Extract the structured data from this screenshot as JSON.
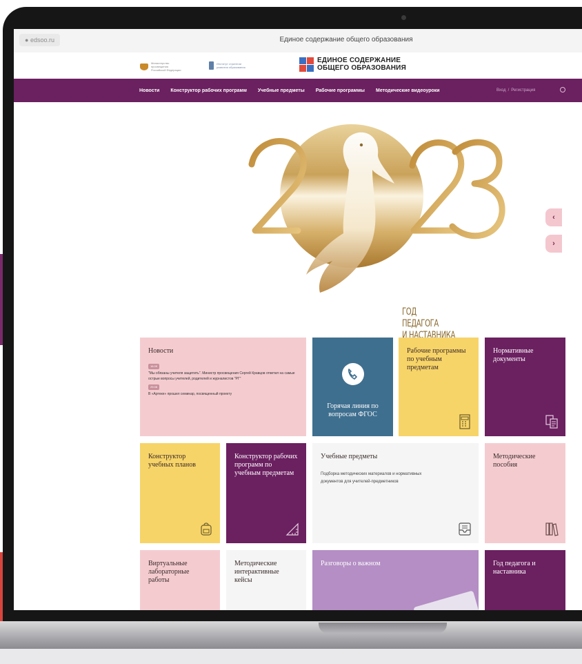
{
  "browser": {
    "url": "edsoo.ru",
    "tab_title": "Единое содержание общего образования"
  },
  "header": {
    "logo_ministry": "Министерство просвещения Российской Федерации",
    "logo_institute": "Институт стратегии развития образования",
    "logo_main_line1": "ЕДИНОЕ СОДЕРЖАНИЕ",
    "logo_main_line2": "ОБЩЕГО ОБРАЗОВАНИЯ"
  },
  "nav": {
    "items": [
      "Новости",
      "Конструктор рабочих программ",
      "Учебные предметы",
      "Рабочие программы",
      "Методические видеоуроки"
    ],
    "login": "Вход",
    "separator": "/",
    "register": "Регистрация"
  },
  "hero": {
    "year_left": "2",
    "year_right": "23",
    "caption": [
      "ГОД",
      "ПЕДАГОГА",
      "И НАСТАВНИКА"
    ],
    "arrow_prev": "‹",
    "arrow_next": "›",
    "slide_count": 4,
    "active_slide": 0
  },
  "colors": {
    "purple": "#6b2060",
    "pink": "#f4ccd0",
    "yellow": "#f7d468",
    "blue": "#3f6f8f",
    "lavender": "#b48ec4",
    "light": "#f5f5f5",
    "gold": "#c59a4a"
  },
  "tiles": {
    "news": {
      "title": "Новости",
      "items": [
        {
          "date": "16.09",
          "text": "\"Мы обязаны учителя защитить\". Министр просвещения Сергей Кравцов ответил на самые острые вопросы учителей, родителей и журналистов \"РГ\""
        },
        {
          "date": "29.08",
          "text": "В «Артеке» прошел семинар, посвященный проекту"
        }
      ]
    },
    "hotline": {
      "title": "Горячая линия по вопросам ФГОС"
    },
    "work_programs": {
      "title": "Рабочие программы по учебным предметам"
    },
    "normative": {
      "title": "Нормативные документы"
    },
    "plans_constructor": {
      "title": "Конструктор учебных планов"
    },
    "programs_constructor": {
      "title": "Конструктор рабочих программ по учебным предметам"
    },
    "subjects": {
      "title": "Учебные предметы",
      "description": "Подборка методических материалов и нормативных документов для учителей-предметников"
    },
    "methodical_guides": {
      "title": "Методические пособия"
    },
    "virtual_labs": {
      "title": "Виртуальные лабораторные работы"
    },
    "interactive_cases": {
      "title": "Методические интерактивные кейсы"
    },
    "conversations": {
      "title": "Разговоры о важном"
    },
    "teacher_year": {
      "title": "Год педагога и наставника"
    }
  }
}
